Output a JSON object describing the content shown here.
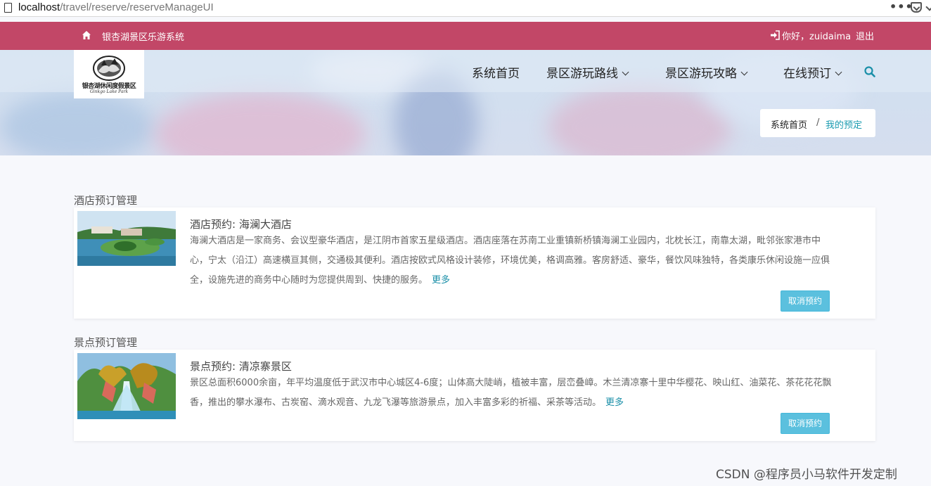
{
  "browser": {
    "url_host": "localhost",
    "url_path": "/travel/reserve/reserveManageUI",
    "menu_icon": "more-dots-icon",
    "pocket_icon": "pocket-icon"
  },
  "topbar": {
    "home_icon": "home-icon",
    "site_name": "银杏湖景区乐游系统",
    "login_icon": "sign-in-icon",
    "greeting": "你好，zuidaima",
    "logout_label": "退出",
    "color": "#c24767"
  },
  "logo": {
    "cn_text": "银杏湖休闲度假景区",
    "script_text": "Ginkgo Lake Park"
  },
  "nav": {
    "home": "系统首页",
    "routes": "景区游玩路线",
    "guides": "景区游玩攻略",
    "booking": "在线预订",
    "search_icon": "search-icon"
  },
  "breadcrumb": {
    "home": "系统首页",
    "separator": "/",
    "current": "我的预定"
  },
  "hotel_section": {
    "title": "酒店预订管理",
    "card": {
      "title": "酒店预约: 海澜大酒店",
      "description": "海澜大酒店是一家商务、会议型豪华酒店，是江阴市首家五星级酒店。酒店座落在苏南工业重镇新桥镇海澜工业园内，北枕长江，南靠太湖，毗邻张家港市中心，宁太（沿江）高速横亘其侧，交通极其便利。酒店按欧式风格设计装修，环境优美，格调高雅。客房舒适、豪华，餐饮风味独特，各类康乐休闲设施一应俱全，设施先进的商务中心随时为您提供周到、快捷的服务。",
      "more_label": "更多",
      "cancel_label": "取消预约"
    }
  },
  "scenic_section": {
    "title": "景点预订管理",
    "card": {
      "title": "景点预约: 清凉寨景区",
      "description": "景区总面积6000余亩，年平均温度低于武汉市中心城区4-6度；山体高大陡峭，植被丰富，层峦叠嶂。木兰清凉寨十里中华樱花、映山红、油菜花、茶花花花飘香，推出的攀水瀑布、古炭窑、滴水观音、九龙飞瀑等旅游景点，加入丰富多彩的祈福、采茶等活动。",
      "more_label": "更多",
      "cancel_label": "取消预约"
    }
  },
  "accent_color": "#5bc0de",
  "link_color": "#1a8fa8",
  "watermark": "CSDN @程序员小马软件开发定制"
}
